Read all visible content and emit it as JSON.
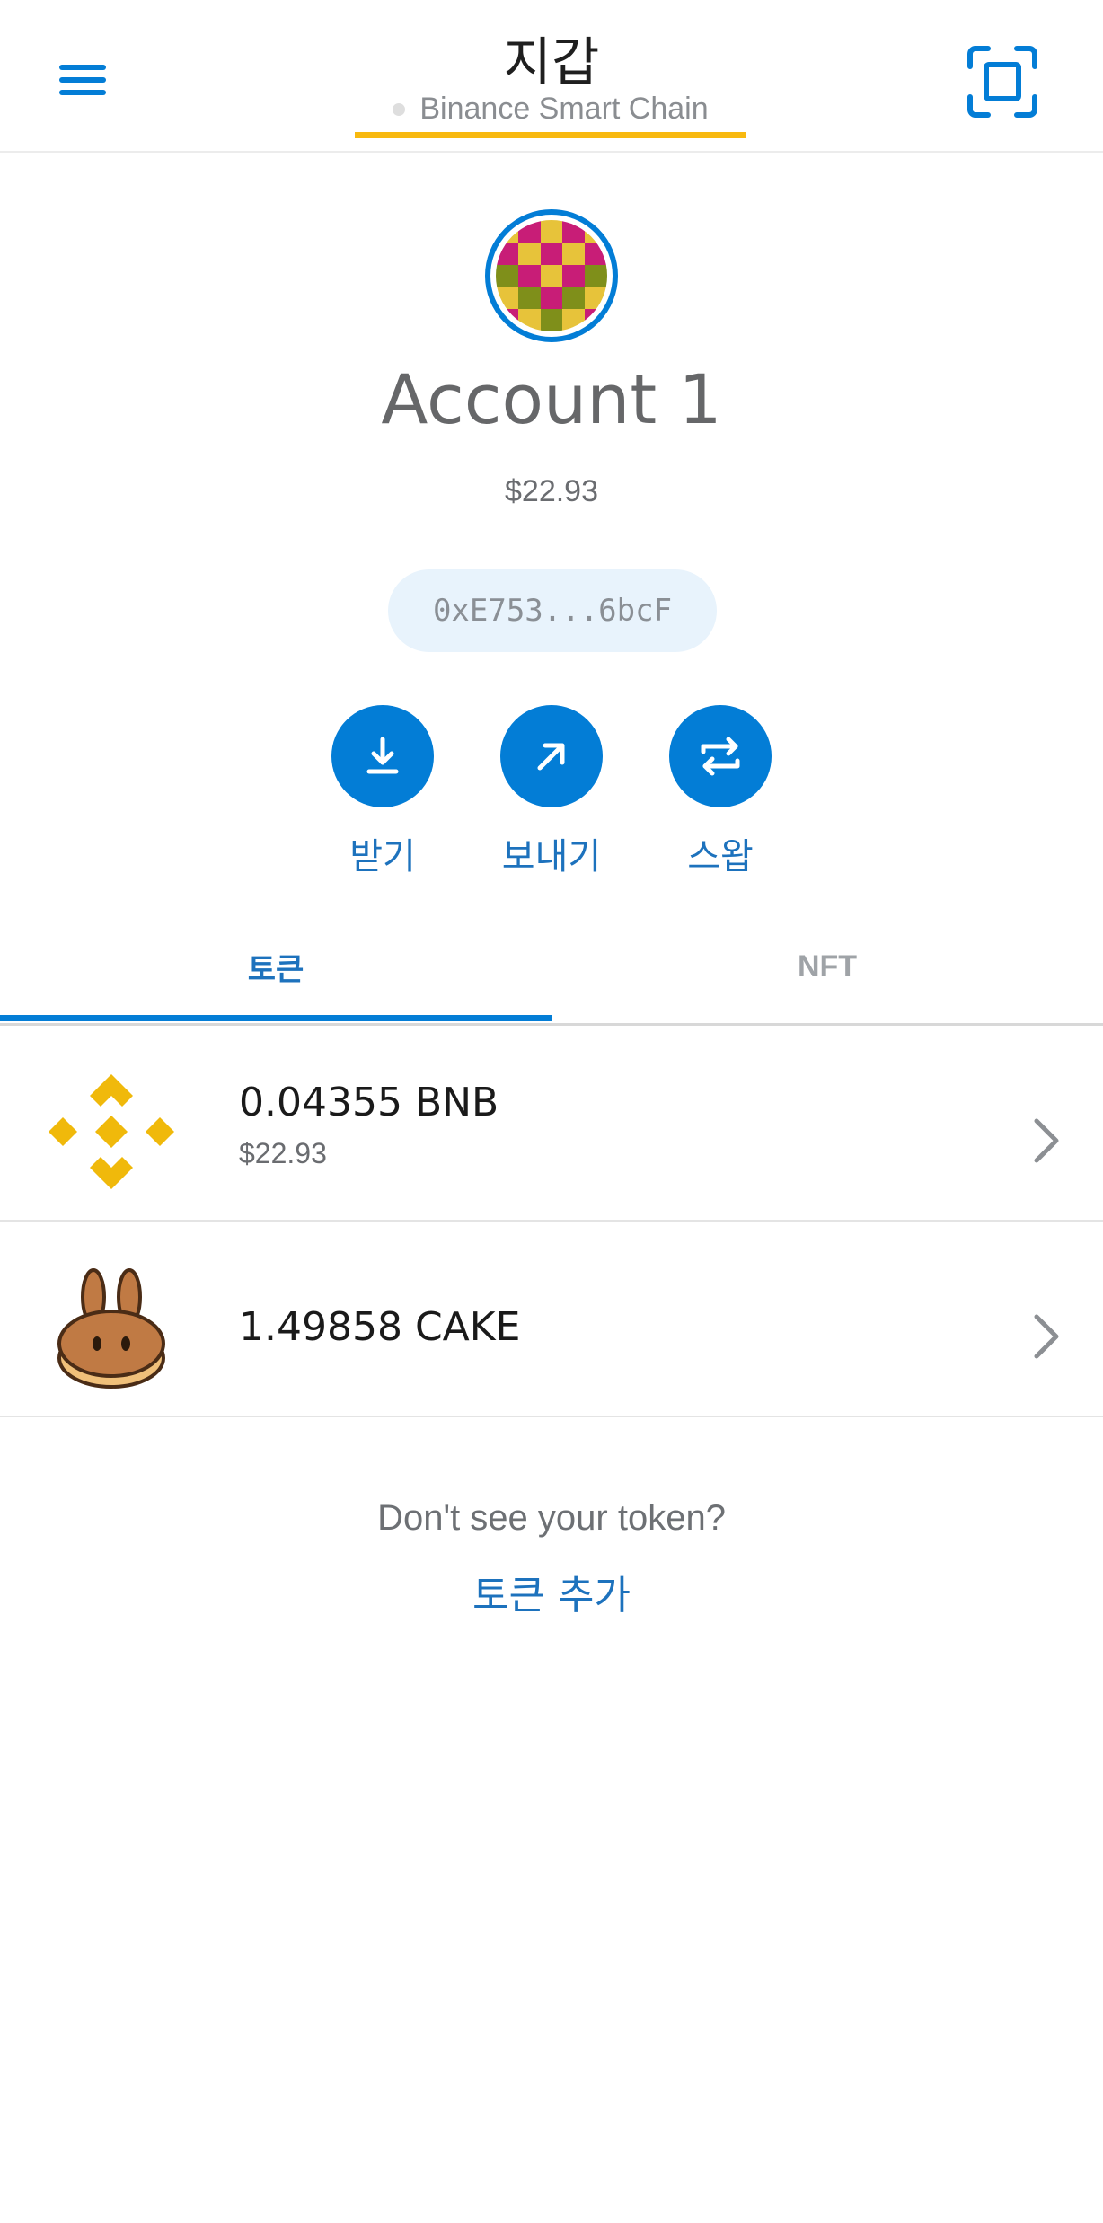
{
  "header": {
    "title": "지갑",
    "network": "Binance Smart Chain",
    "menu_icon": "hamburger-menu-icon",
    "scan_icon": "qr-scan-icon"
  },
  "account": {
    "name": "Account 1",
    "balance": "$22.93",
    "address": "0xE753...6bcF"
  },
  "actions": [
    {
      "label": "받기",
      "icon": "download-icon"
    },
    {
      "label": "보내기",
      "icon": "arrow-up-right-icon"
    },
    {
      "label": "스왑",
      "icon": "swap-icon"
    }
  ],
  "tabs": [
    {
      "label": "토큰",
      "active": true
    },
    {
      "label": "NFT",
      "active": false
    }
  ],
  "tokens": [
    {
      "amount": "0.04355 BNB",
      "fiat": "$22.93",
      "icon": "bnb-logo-icon"
    },
    {
      "amount": "1.49858 CAKE",
      "fiat": "",
      "icon": "pancakeswap-logo-icon"
    }
  ],
  "footer": {
    "prompt": "Don't see your token?",
    "add_token": "토큰 추가"
  },
  "colors": {
    "accent": "#037dd6",
    "network_underline": "#f8b90f",
    "address_pill_bg": "#e8f3fc"
  }
}
